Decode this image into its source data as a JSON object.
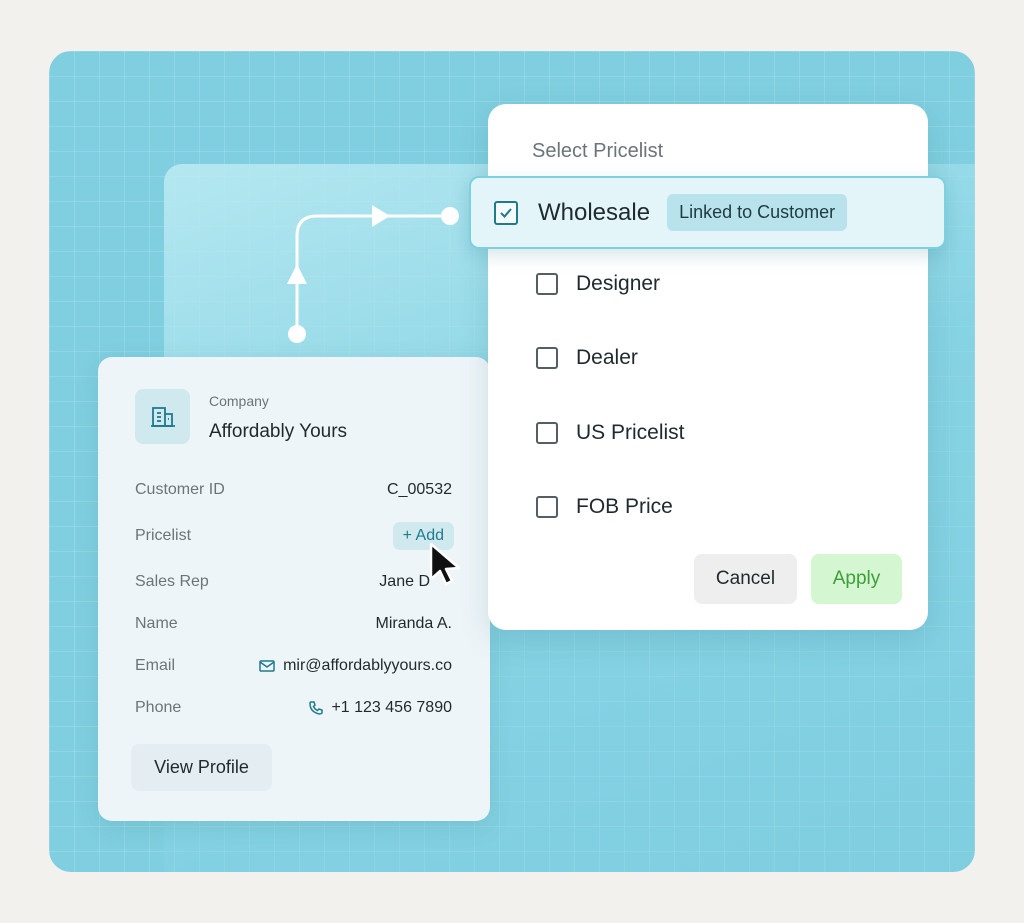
{
  "customer_card": {
    "company_label": "Company",
    "company_name": "Affordably Yours",
    "rows": [
      {
        "label": "Customer ID",
        "value": "C_00532"
      },
      {
        "label": "Pricelist",
        "value": "+ Add"
      },
      {
        "label": "Sales Rep",
        "value": "Jane D"
      },
      {
        "label": "Name",
        "value": "Miranda A."
      },
      {
        "label": "Email",
        "value": "mir@affordablyyours.co"
      },
      {
        "label": "Phone",
        "value": "+1 123 456 7890"
      }
    ],
    "view_profile": "View Profile"
  },
  "pricelist_panel": {
    "title": "Select Pricelist",
    "selected": {
      "label": "Wholesale",
      "badge": "Linked to Customer",
      "checked": true
    },
    "options": [
      {
        "label": "Designer",
        "checked": false
      },
      {
        "label": "Dealer",
        "checked": false
      },
      {
        "label": "US Pricelist",
        "checked": false
      },
      {
        "label": "FOB Price",
        "checked": false
      }
    ],
    "cancel": "Cancel",
    "apply": "Apply"
  },
  "colors": {
    "background": "#f2f1ee",
    "stage": "#7fcfe0",
    "accent": "#1f7a8c",
    "apply_bg": "#d4f7d2",
    "apply_text": "#3f9e3a"
  },
  "icons": [
    "building-icon",
    "mail-icon",
    "phone-icon",
    "checkmark-icon",
    "cursor-icon"
  ]
}
